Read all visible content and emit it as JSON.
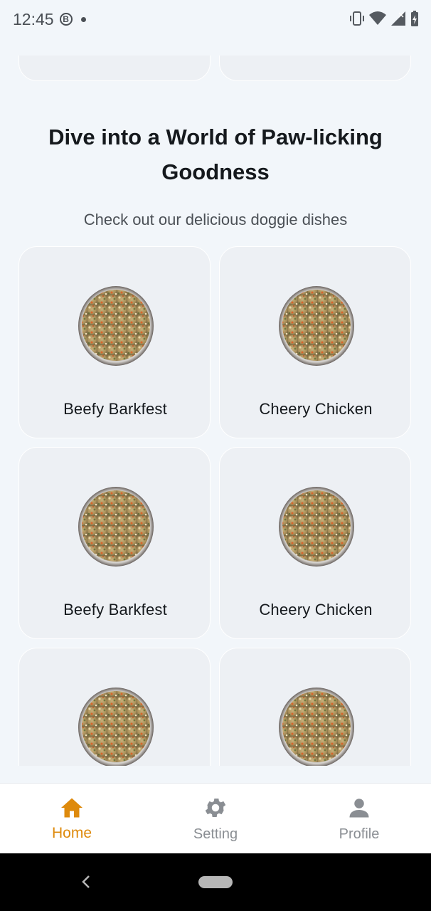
{
  "status_bar": {
    "time": "12:45",
    "b_badge": "B"
  },
  "section": {
    "title": "Dive into a World of Paw-licking Goodness",
    "subtitle": "Check out our delicious doggie dishes"
  },
  "dishes": [
    {
      "name": "Beefy Barkfest",
      "image": "dog-food-bowl"
    },
    {
      "name": "Cheery Chicken",
      "image": "dog-food-bowl"
    },
    {
      "name": "Beefy Barkfest",
      "image": "dog-food-bowl"
    },
    {
      "name": "Cheery Chicken",
      "image": "dog-food-bowl"
    },
    {
      "name": "",
      "image": "dog-food-bowl"
    },
    {
      "name": "",
      "image": "dog-food-bowl"
    }
  ],
  "bottom_nav": {
    "items": [
      {
        "label": "Home",
        "icon": "home-icon",
        "active": true
      },
      {
        "label": "Setting",
        "icon": "gear-icon",
        "active": false
      },
      {
        "label": "Profile",
        "icon": "person-icon",
        "active": false
      }
    ]
  },
  "colors": {
    "accent": "#de8a0c",
    "background": "#f2f6fa",
    "card": "#edf0f4",
    "inactive": "#8a8e93"
  }
}
